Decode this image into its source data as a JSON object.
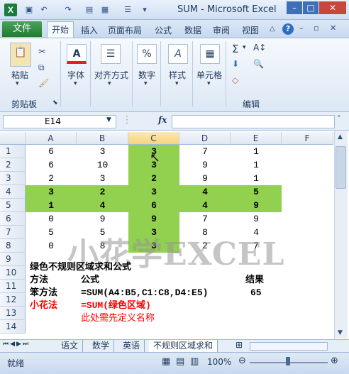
{
  "title": "SUM - Microsoft Excel",
  "tabs": [
    "文件",
    "开始",
    "插入",
    "页面布局",
    "公式",
    "数据",
    "审阅",
    "视图"
  ],
  "ribbon": {
    "paste": "粘贴",
    "clipboard": "剪贴板",
    "font": "字体",
    "alignment": "对齐方式",
    "number": "数字",
    "styles": "样式",
    "cells": "单元格",
    "editing": "编辑",
    "sigma": "Σ",
    "number_icon": "%"
  },
  "formula_bar": {
    "name_box": "E14",
    "fx": "fx"
  },
  "columns": [
    "A",
    "B",
    "C",
    "D",
    "E",
    "F"
  ],
  "rows": [
    "1",
    "2",
    "3",
    "4",
    "5",
    "6",
    "7",
    "8",
    "9",
    "10",
    "11",
    "12",
    "13",
    "14"
  ],
  "cells": [
    [
      "6",
      "3",
      "3",
      "7",
      "1"
    ],
    [
      "6",
      "10",
      "3",
      "9",
      "1"
    ],
    [
      "2",
      "3",
      "2",
      "9",
      "1"
    ],
    [
      "3",
      "2",
      "3",
      "4",
      "5"
    ],
    [
      "1",
      "4",
      "6",
      "4",
      "9"
    ],
    [
      "0",
      "9",
      "9",
      "7",
      "9"
    ],
    [
      "5",
      "5",
      "3",
      "8",
      "4"
    ],
    [
      "0",
      "8",
      "3",
      "2",
      "7"
    ]
  ],
  "notes": {
    "row10": "绿色不规则区域求和公式",
    "row11_a": "方法",
    "row11_b": "公式",
    "row11_e": "结果",
    "row12_a": "笨方法",
    "row12_b": "=SUM(A4:B5,C1:C8,D4:E5)",
    "row12_e": "65",
    "row13_a": "小花法",
    "row13_b": "=SUM(绿色区域)",
    "row14_b": "此处需先定义名称"
  },
  "watermark": "小花学EXCEL",
  "sheet_tabs": [
    "语文",
    "数学",
    "英语",
    "不规则区域求和"
  ],
  "status": {
    "ready": "就绪",
    "zoom": "100%"
  },
  "colors": {
    "green_fill": "#92d050",
    "file_tab": "#2e7d32",
    "red_text": "#ff0000"
  }
}
